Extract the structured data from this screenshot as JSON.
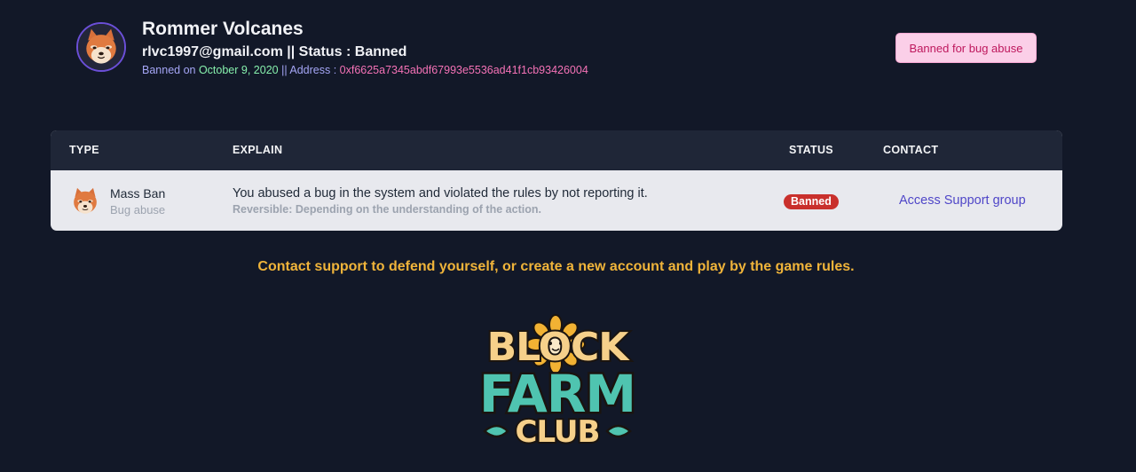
{
  "profile": {
    "name": "Rommer Volcanes",
    "email": "rlvc1997@gmail.com",
    "status_separator": " || Status : ",
    "status": "Banned",
    "banned_on_label": "Banned on ",
    "banned_on_date": "October 9, 2020",
    "address_label": " || Address : ",
    "address": "0xf6625a7345abdf67993e5536ad41f1cb93426004",
    "avatar_icon": "shiba-dog-icon"
  },
  "ban_badge": "Banned for bug abuse",
  "table": {
    "headers": {
      "type": "TYPE",
      "explain": "EXPLAIN",
      "status": "STATUS",
      "contact": "CONTACT"
    },
    "rows": [
      {
        "type": "Mass Ban",
        "type_sub": "Bug abuse",
        "explain": "You abused a bug in the system and violated the rules by not reporting it.",
        "explain_sub": "Reversible: Depending on the understanding of the action.",
        "status": "Banned",
        "contact": "Access Support group",
        "icon": "shiba-dog-icon"
      }
    ]
  },
  "support_message": "Contact support to defend yourself, or create a new account and play by the game rules.",
  "logo": {
    "line1": "BLOCK",
    "line2": "FARM",
    "line3": "CLUB"
  },
  "colors": {
    "background": "#121828",
    "badge_bg": "#fbcfe8",
    "badge_text": "#be185d",
    "status_banned": "#c9302c",
    "support_message": "#f0b43a",
    "link": "#4f46c8",
    "date": "#86efac",
    "address": "#f472b6"
  }
}
